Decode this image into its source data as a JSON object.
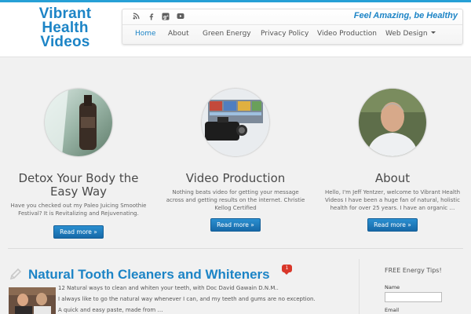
{
  "site": {
    "logo_lines": [
      "Vibrant",
      "Health",
      "Videos"
    ],
    "tagline": "Feel Amazing, be Healthy",
    "colors": {
      "brand": "#1c84c6",
      "topbar": "#27a0d6",
      "button": "#1c76b8",
      "badge": "#d9372a"
    }
  },
  "social_icons": [
    "rss-icon",
    "facebook-icon",
    "google-plus-icon",
    "youtube-icon"
  ],
  "nav": {
    "items": [
      {
        "label": "Home",
        "active": true
      },
      {
        "label": "About"
      },
      {
        "label": "Green Energy"
      },
      {
        "label": "Privacy Policy"
      },
      {
        "label": "Video Production"
      },
      {
        "label": "Web Design",
        "has_dropdown": true
      }
    ]
  },
  "featured": [
    {
      "title_lines": [
        "Detox Your Body the",
        "Easy Way"
      ],
      "text_lines": [
        "Have you checked out my Paleo Juicing Smoothie",
        "Festival? It is Revitalizing and Rejuvenating."
      ],
      "button": "Read more »"
    },
    {
      "title_lines": [
        "Video Production"
      ],
      "text_lines": [
        "Nothing beats video for getting your message",
        "across and getting results on the internet. Christie",
        "Kellog Certified"
      ],
      "button": "Read more »"
    },
    {
      "title_lines": [
        "About"
      ],
      "text_lines": [
        "Hello, I'm Jeff Yentzer, welcome to Vibrant Health",
        "Videos I have been a huge fan of natural, holistic",
        "health for over 25 years. I have an organic …"
      ],
      "button": "Read more »"
    }
  ],
  "post": {
    "title": "Natural Tooth Cleaners and Whiteners",
    "comment_count": "1",
    "excerpt_lines": [
      "12 Natural ways to clean and whiten your teeth, with Doc David Gawain D.N.M..",
      "I always like to go the natural way whenever I can, and my teeth and gums are no exception.",
      "A quick and easy paste, made from …"
    ]
  },
  "sidebar": {
    "title": "FREE Energy Tips!",
    "name_label": "Name",
    "email_label": "Email",
    "name_value": "",
    "email_value": ""
  }
}
